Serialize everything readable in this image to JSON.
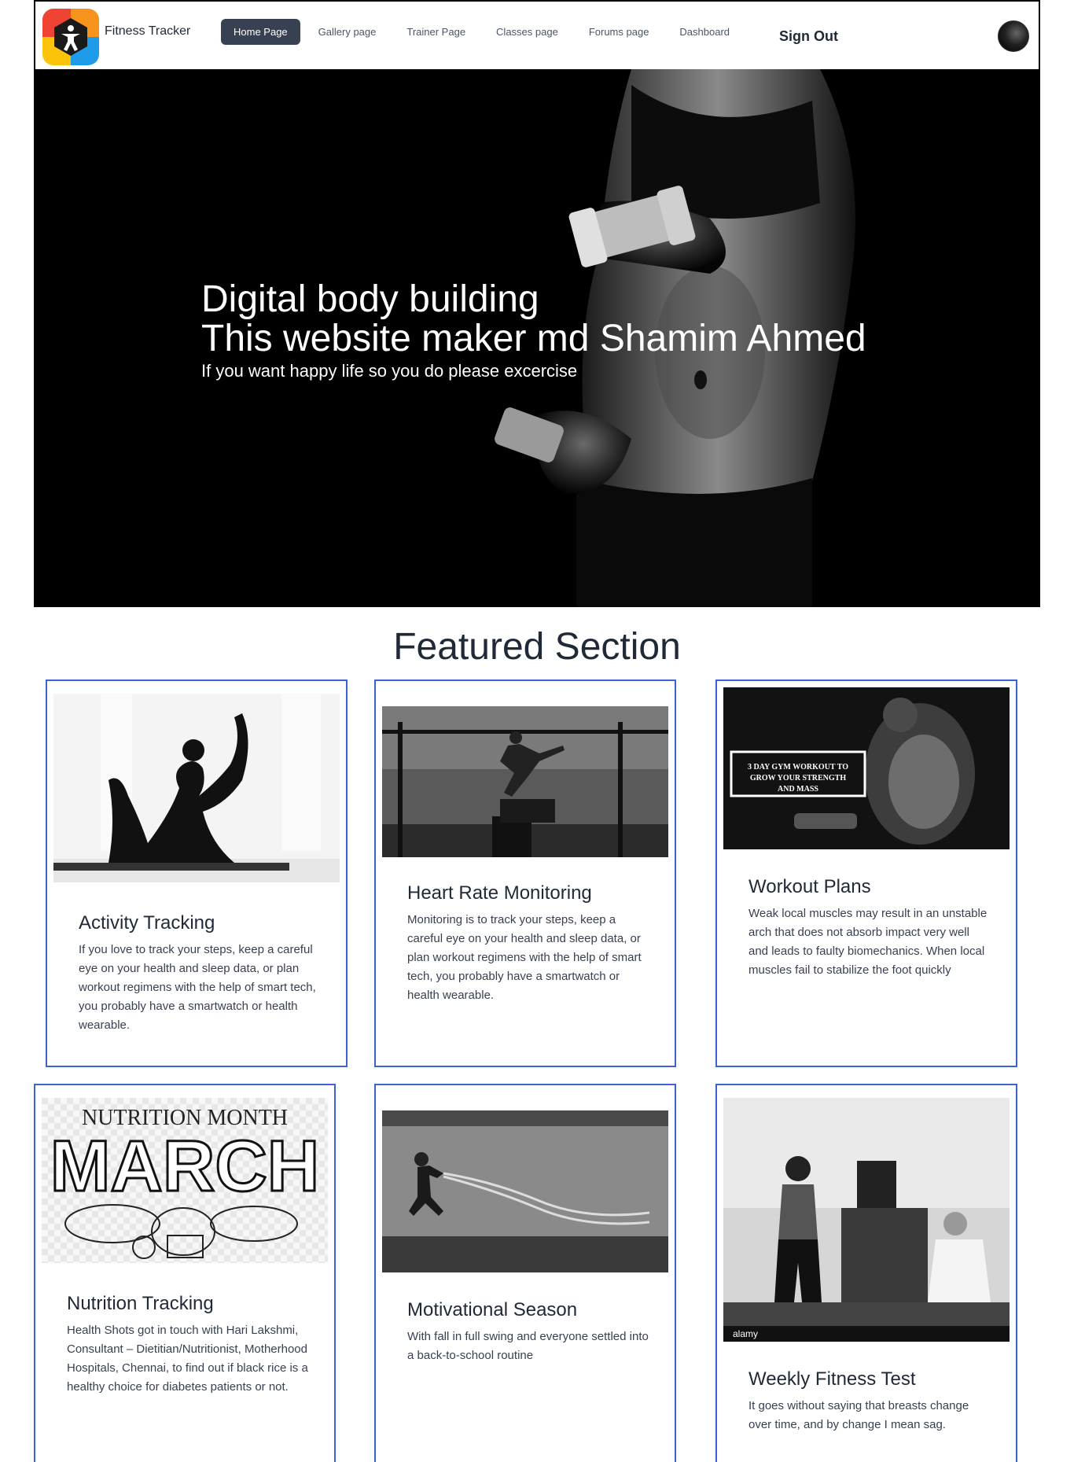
{
  "brand": {
    "name": "Fitness Tracker"
  },
  "nav": {
    "links": [
      "Home Page",
      "Gallery page",
      "Trainer Page",
      "Classes page",
      "Forums page",
      "Dashboard"
    ],
    "active": "Home Page",
    "sign_out": "Sign Out"
  },
  "hero": {
    "line1": "Digital body building",
    "line2": "This website maker md Shamim Ahmed",
    "subtitle": "If you want happy life so you do please excercise"
  },
  "featured": {
    "title": "Featured Section",
    "cards": [
      {
        "title": "Activity Tracking",
        "text": "If you love to track your steps, keep a careful eye on your health and sleep data, or plan workout regimens with the help of smart tech, you probably have a smartwatch or health wearable."
      },
      {
        "title": "Heart Rate Monitoring",
        "text": "Monitoring is to track your steps, keep a careful eye on your health and sleep data, or plan workout regimens with the help of smart tech, you probably have a smartwatch or health wearable."
      },
      {
        "title": "Workout Plans",
        "text": "Weak local muscles may result in an unstable arch that does not absorb impact very well and leads to faulty biomechanics. When local muscles fail to stabilize the foot quickly",
        "image_caption": "3 DAY GYM WORKOUT TO GROW YOUR STRENGTH AND MASS"
      },
      {
        "title": "Nutrition Tracking",
        "text": "Health Shots got in touch with Hari Lakshmi, Consultant – Dietitian/Nutritionist, Motherhood Hospitals, Chennai, to find out if black rice is a healthy choice for diabetes patients or not.",
        "image_line1": "NUTRITION MONTH",
        "image_line2": "MARCH"
      },
      {
        "title": "Motivational Season",
        "text": "With fall in full swing and everyone settled into a back-to-school routine"
      },
      {
        "title": "Weekly Fitness Test",
        "text": "It goes without saying that breasts change over time, and by change I mean sag.",
        "watermark": "alamy"
      }
    ]
  },
  "colors": {
    "card_border": "#3b63d6",
    "active_nav": "#374151",
    "hero_bg": "#000000"
  }
}
